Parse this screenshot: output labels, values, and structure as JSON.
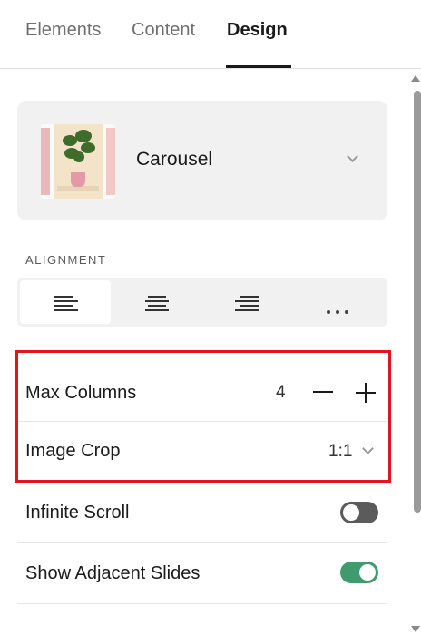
{
  "tabs": [
    {
      "label": "Elements",
      "active": false
    },
    {
      "label": "Content",
      "active": false
    },
    {
      "label": "Design",
      "active": true
    }
  ],
  "layout": {
    "name": "Carousel",
    "thumbnail": "plant-in-pink-pot"
  },
  "alignment": {
    "label": "ALIGNMENT",
    "options": [
      "align-left-icon",
      "align-center-icon",
      "align-right-icon",
      "more-options-icon"
    ],
    "selected": "align-left-icon"
  },
  "settings": {
    "max_columns": {
      "label": "Max Columns",
      "value": "4"
    },
    "image_crop": {
      "label": "Image Crop",
      "value": "1:1"
    },
    "infinite_scroll": {
      "label": "Infinite Scroll",
      "enabled": false
    },
    "adjacent_slides": {
      "label": "Show Adjacent Slides",
      "enabled": true
    }
  },
  "colors": {
    "highlight": "#e0161c",
    "toggle_on": "#3f9b6e",
    "toggle_off": "#5b5b5b"
  }
}
